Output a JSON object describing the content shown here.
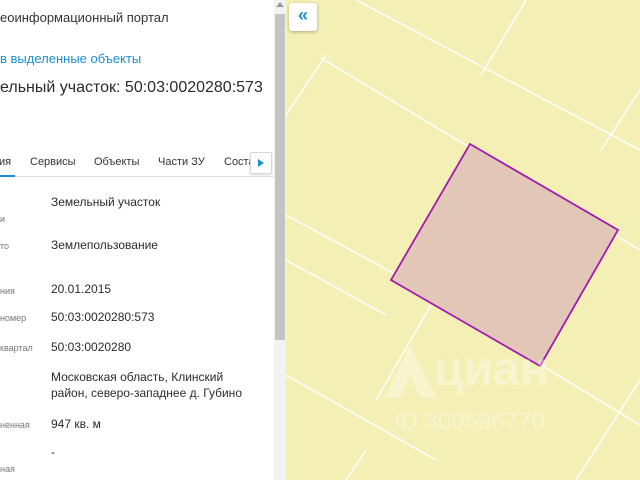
{
  "panel": {
    "portal_title": "еоинформационный портал",
    "selected_link": "в выделенные объекты",
    "object_title": "ельный участок: 50:03:0020280:573",
    "tabs": [
      {
        "label": "ия"
      },
      {
        "label": "Сервисы"
      },
      {
        "label": "Объекты"
      },
      {
        "label": "Части ЗУ"
      },
      {
        "label": "Соста"
      }
    ],
    "rows": [
      {
        "label": "и",
        "value": "Земельный участок"
      },
      {
        "label": "то",
        "value": "Землепользование"
      },
      {
        "label": "ния",
        "value": "20.01.2015"
      },
      {
        "label": "номер",
        "value": "50:03:0020280:573"
      },
      {
        "label": "квартал",
        "value": "50:03:0020280"
      },
      {
        "label": "",
        "value": "Московская область, Клинский район, северо-западнее д. Губино"
      },
      {
        "label": "ненная",
        "value": "947 кв. м"
      },
      {
        "label": "",
        "value": "-"
      },
      {
        "label": "ная",
        "value": ""
      }
    ]
  },
  "map": {
    "collapse_icon": "«",
    "watermark_brand": "циан",
    "watermark_id": "ID 300596770",
    "colors": {
      "background": "#f4efb4",
      "parcel_lines": "#ffffff",
      "selected_fill": "#e2c7b8",
      "selected_stroke": "#a21caf"
    }
  }
}
